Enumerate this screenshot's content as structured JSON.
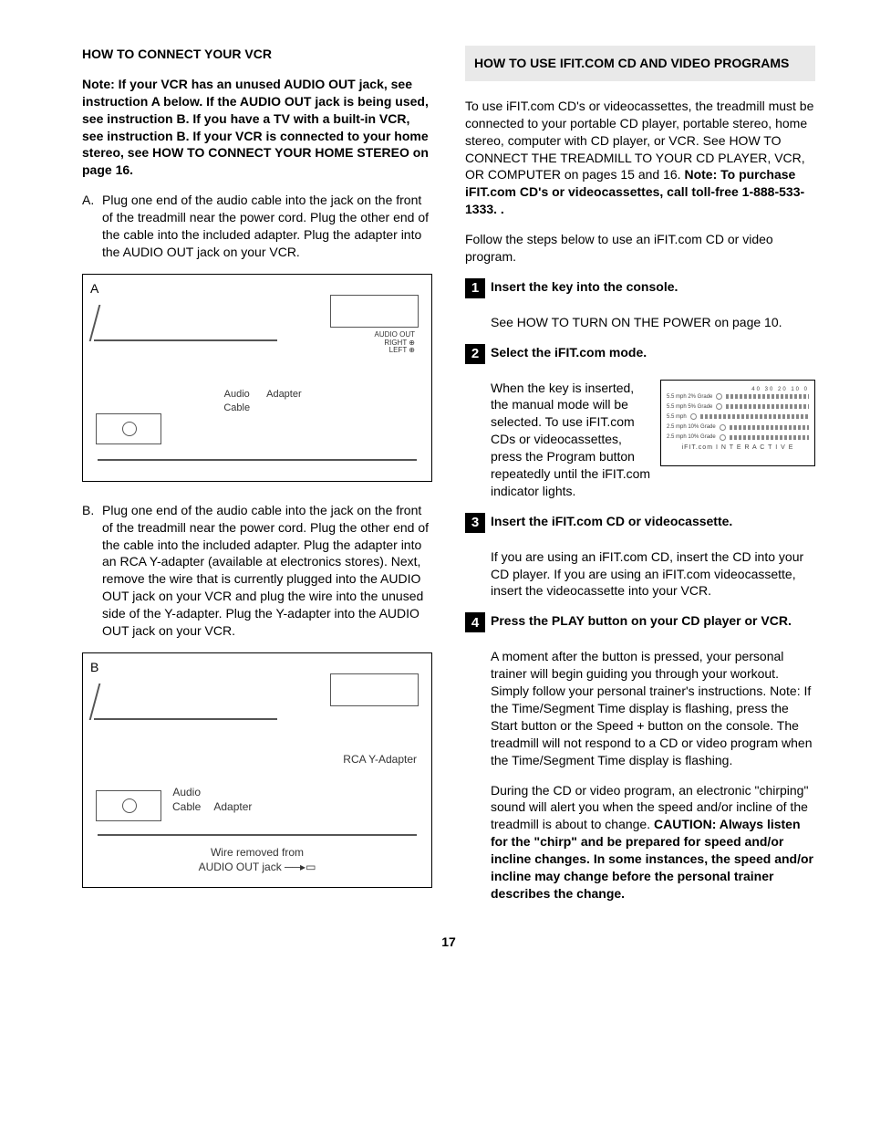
{
  "page_number": "17",
  "left": {
    "heading": "HOW TO CONNECT YOUR VCR",
    "note": "Note: If your VCR has an unused AUDIO OUT jack, see instruction A below. If the AUDIO OUT jack is being used, see instruction B. If you have a TV with a built-in VCR, see instruction B. If your VCR is connected to your home stereo, see HOW TO CONNECT YOUR HOME STEREO on page 16.",
    "itemA_marker": "A.",
    "itemA_body": "Plug one end of the audio cable into the jack on the front of the treadmill near the power cord. Plug the other end of the cable into the included adapter. Plug the adapter into the AUDIO OUT jack on your VCR.",
    "figA_label": "A",
    "figA_audio_cable": "Audio\nCable",
    "figA_adapter": "Adapter",
    "figA_audio_out": "AUDIO OUT",
    "figA_right": "RIGHT",
    "figA_left": "LEFT",
    "itemB_marker": "B.",
    "itemB_body": "Plug one end of the audio cable into the jack on the front of the treadmill near the power cord. Plug the other end of the cable into the included adapter. Plug the adapter into an RCA Y-adapter (available at electronics stores). Next, remove the wire that is currently plugged into the AUDIO OUT jack on your VCR and plug the wire into the unused side of the Y-adapter. Plug the Y-adapter into the AUDIO OUT jack on your VCR.",
    "figB_label": "B",
    "figB_audio_cable": "Audio\nCable",
    "figB_adapter": "Adapter",
    "figB_rca": "RCA Y-Adapter",
    "figB_wire": "Wire removed from\nAUDIO OUT jack"
  },
  "right": {
    "shaded_heading": "HOW TO USE IFIT.COM CD AND VIDEO PROGRAMS",
    "intro_plain": "To use iFIT.com CD's or videocassettes, the treadmill must be connected to your portable CD player, portable stereo, home stereo, computer with CD player, or VCR. See HOW TO CONNECT THE TREADMILL TO YOUR CD PLAYER, VCR, OR COMPUTER on pages 15 and 16. ",
    "intro_bold": "Note: To purchase iFIT.com CD's or videocassettes, call toll-free 1-888-533-1333. .",
    "follow": "Follow the steps below to use an iFIT.com CD or video program.",
    "steps": [
      {
        "num": "1",
        "title": "Insert the key into the console.",
        "body": "See HOW TO TURN ON THE POWER on page 10."
      },
      {
        "num": "2",
        "title": "Select the iFIT.com mode.",
        "body": "When the key is inserted, the manual mode will be selected. To use iFIT.com CDs or videocassettes, press the Program button repeatedly until the iFIT.com indicator lights."
      },
      {
        "num": "3",
        "title": "Insert the iFIT.com CD or videocassette.",
        "body": "If you are using an iFIT.com CD, insert the CD into your CD player. If you are using an iFIT.com videocassette, insert the videocassette into your VCR."
      },
      {
        "num": "4",
        "title": "Press the PLAY button on your CD player or VCR.",
        "body": "A moment after the button is pressed, your personal trainer will begin guiding you through your workout. Simply follow your personal trainer's instructions. Note: If the Time/Segment Time display is flashing, press the Start button or the Speed + button on the console. The treadmill will not respond to a CD or video program when the Time/Segment Time display is flashing.",
        "body2_plain": "During the CD or video program, an electronic \"chirping\" sound will alert you when the speed and/or incline of the treadmill is about to change. ",
        "body2_bold": "CAUTION: Always listen for the \"chirp\" and be prepared for speed and/or incline changes. In some instances, the speed and/or incline may change before the personal trainer describes the change."
      }
    ],
    "console_rows": [
      "5.5 mph 2% Grade",
      "5.5 mph 5% Grade",
      "5.5 mph",
      "2.5 mph 10% Grade",
      "2.5 mph 10% Grade"
    ],
    "console_scale": "40    30    20    10    0",
    "console_logo": "iFIT.com  I N T E R A C T I V E"
  }
}
